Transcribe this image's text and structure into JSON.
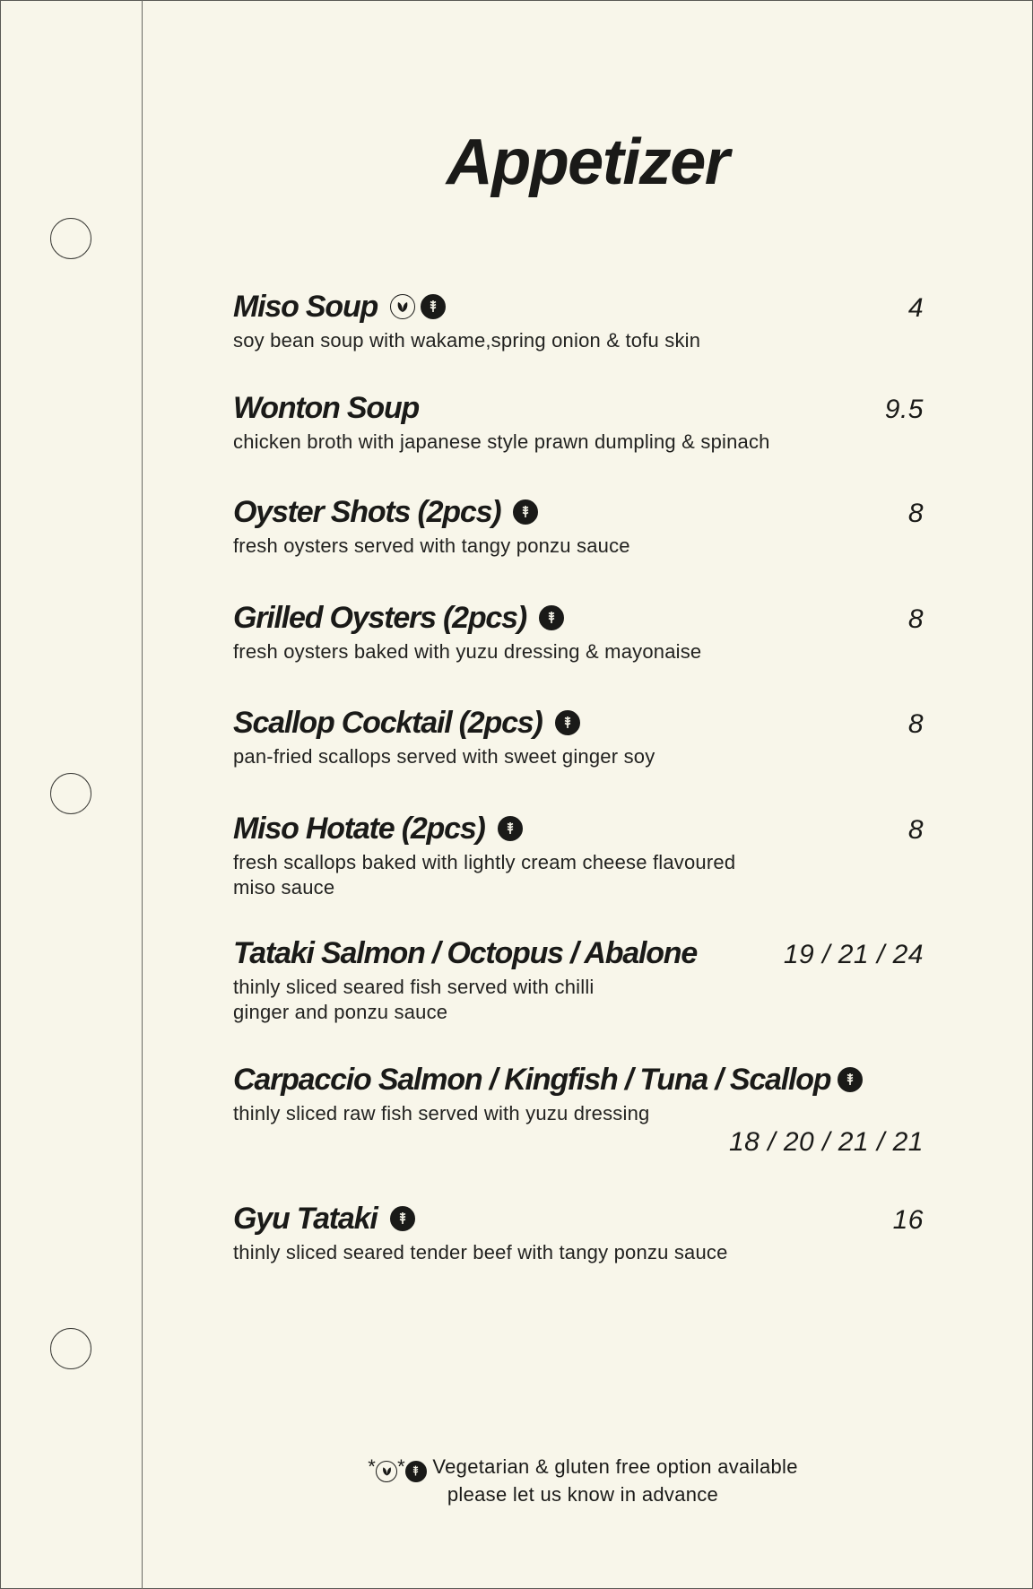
{
  "menu": {
    "title": "Appetizer",
    "items": [
      {
        "name": "Miso Soup",
        "desc": "soy bean soup with wakame,spring onion & tofu skin",
        "price": "4",
        "icons": [
          "vegetarian-icon",
          "gluten-free-icon"
        ]
      },
      {
        "name": "Wonton Soup",
        "desc": "chicken broth with japanese style prawn dumpling & spinach",
        "price": "9.5",
        "icons": []
      },
      {
        "name": "Oyster Shots (2pcs)",
        "desc": "fresh oysters served with tangy ponzu sauce",
        "price": "8",
        "icons": [
          "gluten-free-icon"
        ]
      },
      {
        "name": "Grilled Oysters (2pcs)",
        "desc": "fresh oysters baked with yuzu dressing & mayonaise",
        "price": "8",
        "icons": [
          "gluten-free-icon"
        ]
      },
      {
        "name": "Scallop Cocktail (2pcs)",
        "desc": "pan-fried scallops served with sweet ginger soy",
        "price": "8",
        "icons": [
          "gluten-free-icon"
        ]
      },
      {
        "name": "Miso Hotate (2pcs)",
        "desc_lines": [
          "fresh scallops baked with lightly cream cheese flavoured",
          "miso sauce"
        ],
        "price": "8",
        "icons": [
          "gluten-free-icon"
        ]
      },
      {
        "name": "Tataki Salmon / Octopus / Abalone",
        "desc_lines": [
          "thinly sliced seared fish served with chilli",
          "ginger and ponzu sauce"
        ],
        "price": "19 / 21 / 24",
        "icons": []
      },
      {
        "name": "Carpaccio Salmon / Kingfish / Tuna / Scallop",
        "desc": "thinly sliced raw fish served with yuzu dressing",
        "price": "18 / 20 / 21 / 21",
        "icons": [
          "gluten-free-icon"
        ]
      },
      {
        "name": "Gyu Tataki",
        "desc": "thinly sliced seared tender beef with tangy ponzu sauce",
        "price": "16",
        "icons": [
          "gluten-free-icon"
        ]
      }
    ],
    "footer": {
      "line1_prefix_a": "*",
      "line1_prefix_b": "*",
      "line1": "Vegetarian & gluten free option available",
      "line2": "please let us know in advance"
    },
    "colors": {
      "background": "#f8f6ea",
      "text": "#1a1a18"
    }
  }
}
